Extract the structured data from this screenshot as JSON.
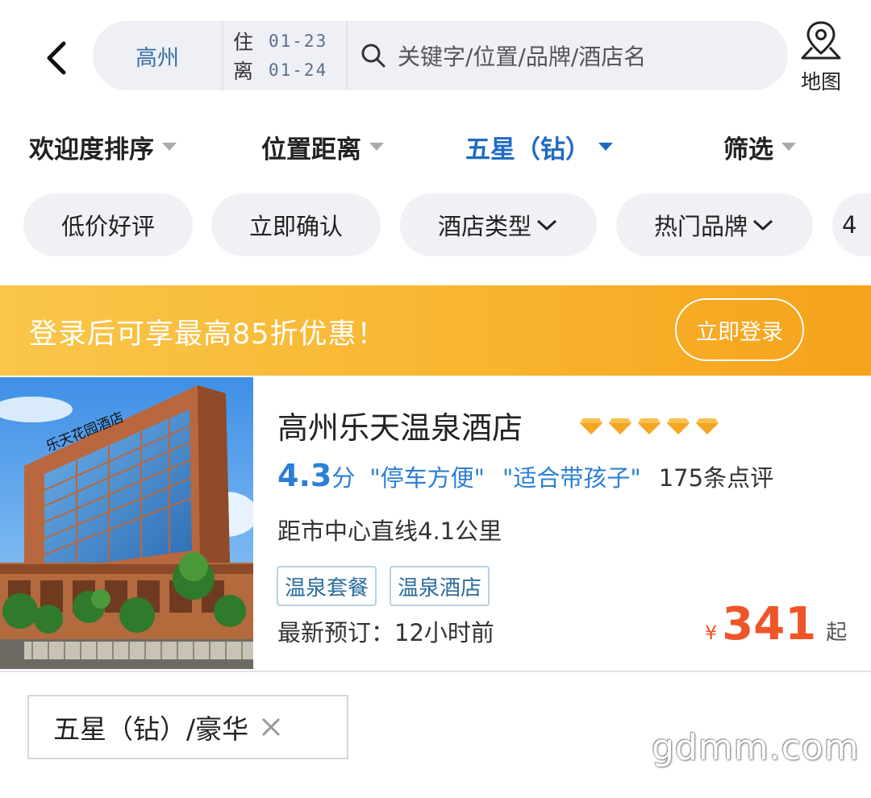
{
  "header": {
    "city": "高州",
    "checkin_label": "住",
    "checkin_date": "01-23",
    "checkout_label": "离",
    "checkout_date": "01-24",
    "search_placeholder": "关键字/位置/品牌/酒店名",
    "map_label": "地图"
  },
  "sort_bar": {
    "items": [
      {
        "label": "欢迎度排序"
      },
      {
        "label": "位置距离"
      },
      {
        "label": "五星（钻）"
      },
      {
        "label": "筛选"
      }
    ]
  },
  "quick_filters": [
    "低价好评",
    "立即确认",
    "酒店类型",
    "热门品牌",
    "4"
  ],
  "banner": {
    "text": "登录后可享最高85折优惠！",
    "button": "立即登录"
  },
  "hotel": {
    "name": "高州乐天温泉酒店",
    "diamond_count": 5,
    "sign_text": "乐天花园酒店",
    "score": "4.3",
    "score_unit": "分",
    "highlights": [
      "\"停车方便\"",
      "\"适合带孩子\""
    ],
    "review_count": "175条点评",
    "distance": "距市中心直线4.1公里",
    "feature_tags": [
      "温泉套餐",
      "温泉酒店"
    ],
    "latest_booking": "最新预订：12小时前",
    "currency": "¥",
    "price": "341",
    "price_suffix": "起"
  },
  "selected_filter": {
    "label": "五星（钻）/豪华"
  },
  "watermark": "gdmm.com",
  "colors": {
    "accent_blue": "#1e6bc4",
    "score_blue": "#2b7fd6",
    "price_orange": "#f0552a",
    "banner_orange": "#f8b52f",
    "diamond_gold": "#f5a623"
  }
}
